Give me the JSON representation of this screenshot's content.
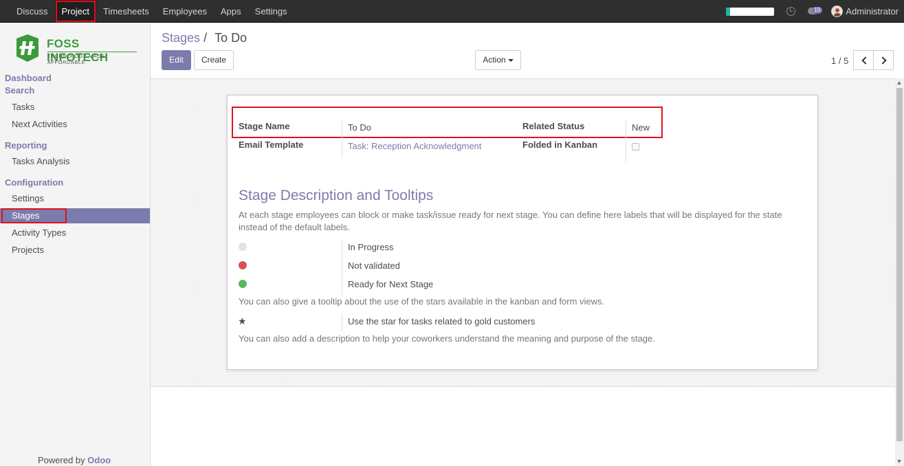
{
  "topbar": {
    "menu": [
      "Discuss",
      "Project",
      "Timesheets",
      "Employees",
      "Apps",
      "Settings"
    ],
    "active": "Project",
    "progress_fraction": 0.08,
    "progress_color": "#21b799",
    "message_count": "10",
    "user": "Administrator"
  },
  "sidebar": {
    "logo_brand": "FOSS INFOTECH",
    "logo_tagline": "TECHNOLOGY MADE AFFORDABLE",
    "dashboard": "Dashboard",
    "search": "Search",
    "tasks": "Tasks",
    "next_activities": "Next Activities",
    "reporting": "Reporting",
    "tasks_analysis": "Tasks Analysis",
    "configuration": "Configuration",
    "settings": "Settings",
    "stages": "Stages",
    "activity_types": "Activity Types",
    "projects": "Projects",
    "powered_prefix": "Powered by ",
    "powered_brand": "Odoo"
  },
  "control": {
    "breadcrumb_parent": "Stages",
    "breadcrumb_sep": "/",
    "breadcrumb_current": "To Do",
    "edit": "Edit",
    "create": "Create",
    "action": "Action",
    "pager": "1 / 5"
  },
  "form": {
    "stage_name_label": "Stage Name",
    "stage_name_value": "To Do",
    "related_status_label": "Related Status",
    "related_status_value": "New",
    "email_template_label": "Email Template",
    "email_template_value": "Task: Reception Acknowledgment",
    "folded_label": "Folded in Kanban",
    "folded_value": false,
    "section_title": "Stage Description and Tooltips",
    "desc1": "At each stage employees can block or make task/issue ready for next stage. You can define here labels that will be displayed for the state instead of the default labels.",
    "legend_normal": "In Progress",
    "legend_blocked": "Not validated",
    "legend_done": "Ready for Next Stage",
    "color_normal": "#e2e2e2",
    "color_blocked": "#d9534f",
    "color_done": "#5cb85c",
    "desc2": "You can also give a tooltip about the use of the stars available in the kanban and form views.",
    "legend_priority": "Use the star for tasks related to gold customers",
    "desc3": "You can also add a description to help your coworkers understand the meaning and purpose of the stage."
  }
}
